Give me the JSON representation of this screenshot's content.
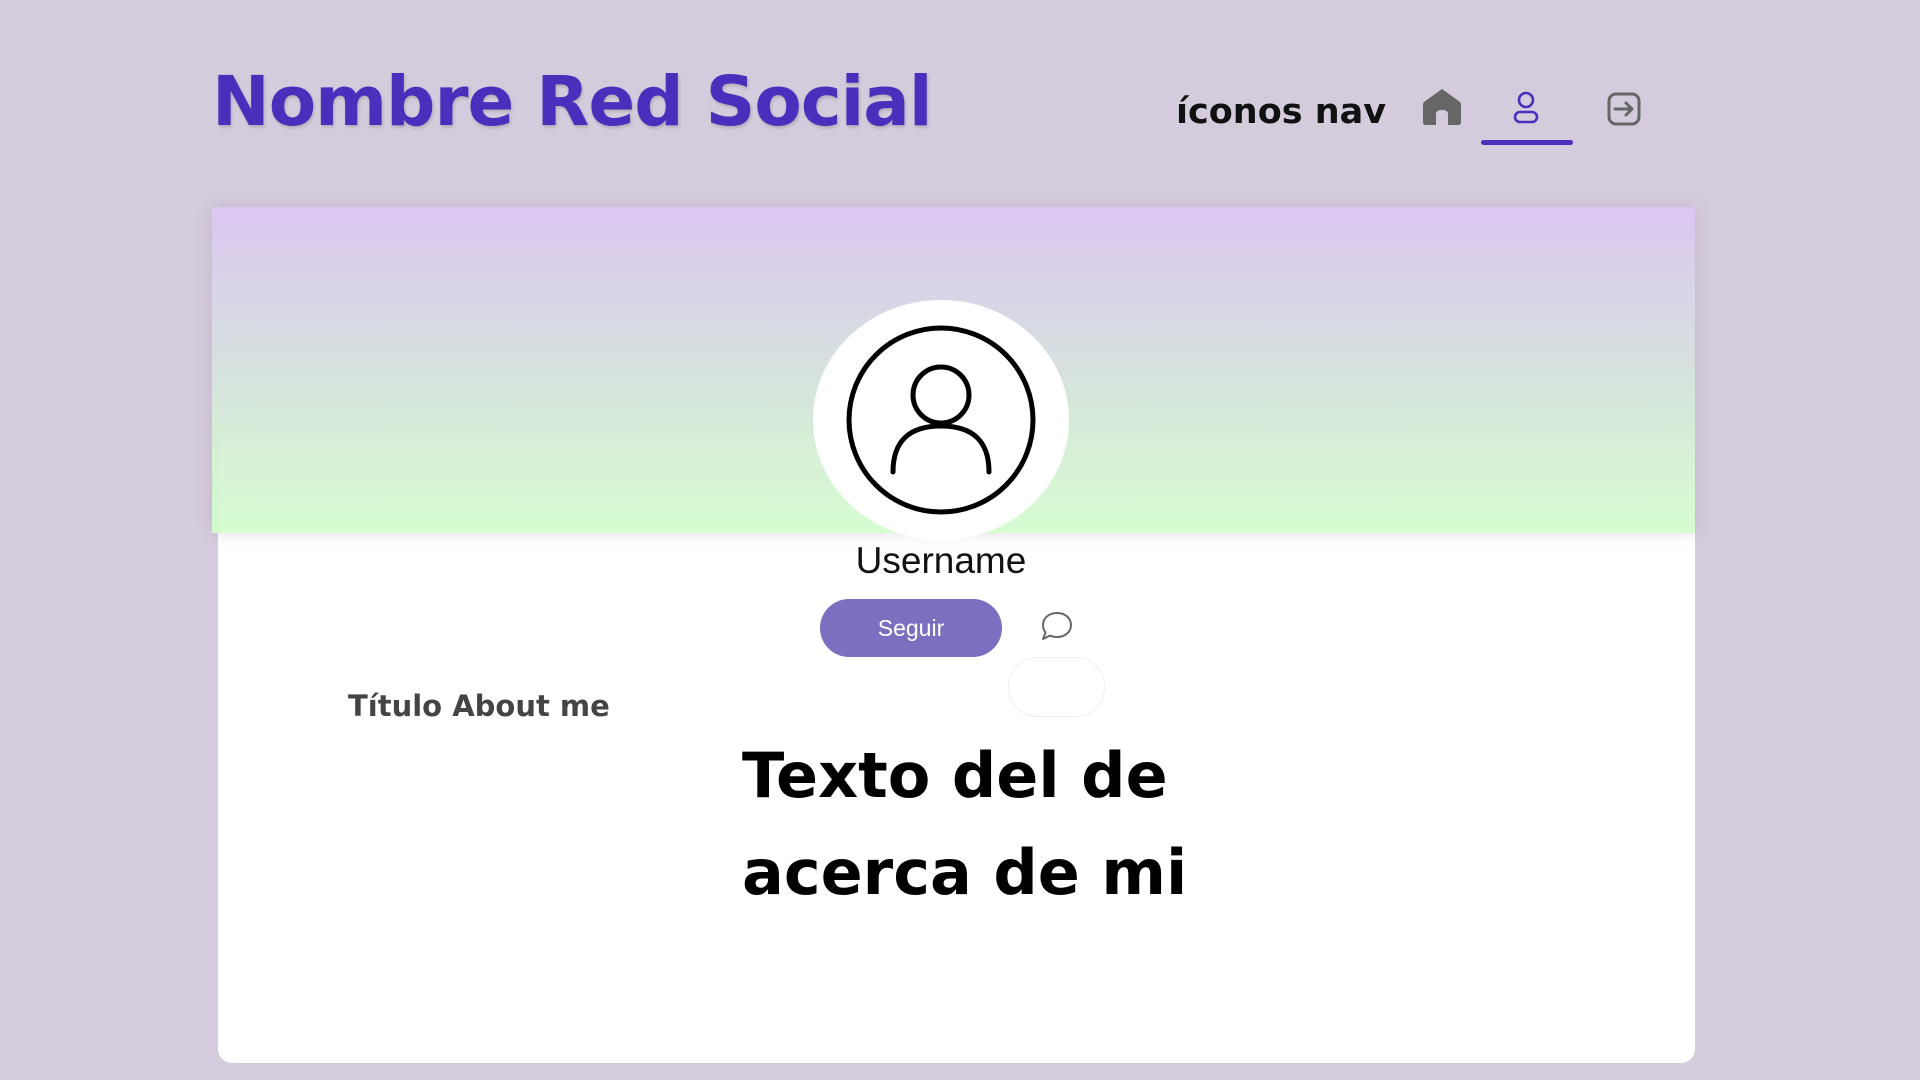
{
  "header": {
    "brand": "Nombre Red Social",
    "nav_label": "íconos nav",
    "nav_items": [
      {
        "icon": "home-icon",
        "active": false
      },
      {
        "icon": "profile-icon",
        "active": true
      },
      {
        "icon": "logout-icon",
        "active": false
      }
    ]
  },
  "profile": {
    "avatar_icon": "user-avatar-icon",
    "username": "Username",
    "follow_label": "Seguir",
    "message_icon": "chat-bubble-icon"
  },
  "about": {
    "title": "Título About me",
    "text": "Texto del de acerca de mi"
  },
  "colors": {
    "brand": "#4a2fbd",
    "follow_button": "#7b6fc0",
    "background": "#d4ccdc",
    "banner_top": "#dbc6f1",
    "banner_bottom": "#d2fccb"
  }
}
